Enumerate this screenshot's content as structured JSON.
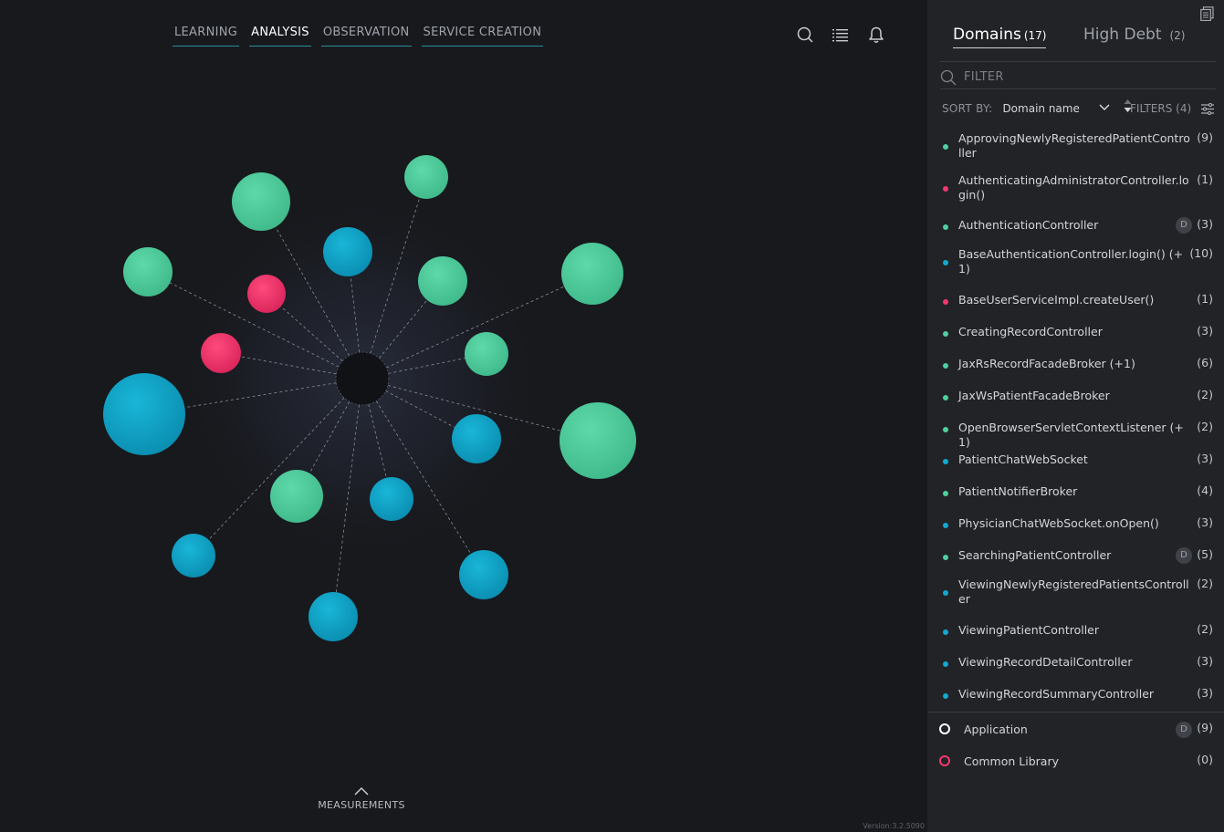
{
  "nav": {
    "tabs": [
      {
        "label": "LEARNING"
      },
      {
        "label": "ANALYSIS"
      },
      {
        "label": "OBSERVATION"
      },
      {
        "label": "SERVICE CREATION"
      }
    ],
    "active_tab": "ANALYSIS"
  },
  "toolbar_icons": [
    "search-icon",
    "list-icon",
    "bell-icon"
  ],
  "measurements": {
    "label": "MEASUREMENTS"
  },
  "version": "Version:3.2.5090",
  "colors": {
    "green": "#4fcf9f",
    "blue": "#12a9cf",
    "pink": "#f2386e",
    "hub": "#111215",
    "background": "#18191d",
    "panel": "#222327"
  },
  "panel": {
    "tabs": [
      {
        "label": "Domains",
        "count": "(17)"
      },
      {
        "label": "High Debt",
        "count": "(2)"
      }
    ],
    "filter_placeholder": "FILTER",
    "sort_by_label": "SORT BY:",
    "sort_value": "Domain name",
    "filters_label": "FILTERS (4)",
    "domains": [
      {
        "name": "ApprovingNewlyRegisteredPatientController",
        "count": "(9)",
        "color": "#4fcf9f",
        "badge": ""
      },
      {
        "name": "AuthenticatingAdministratorController.login()",
        "count": "(1)",
        "color": "#f2386e",
        "badge": ""
      },
      {
        "name": "AuthenticationController",
        "count": "(3)",
        "color": "#4fcf9f",
        "badge": "D"
      },
      {
        "name": "BaseAuthenticationController.login() (+1)",
        "count": "(10)",
        "color": "#12a9cf",
        "badge": ""
      },
      {
        "name": "BaseUserServiceImpl.createUser()",
        "count": "(1)",
        "color": "#f2386e",
        "badge": ""
      },
      {
        "name": "CreatingRecordController",
        "count": "(3)",
        "color": "#4fcf9f",
        "badge": ""
      },
      {
        "name": "JaxRsRecordFacadeBroker (+1)",
        "count": "(6)",
        "color": "#4fcf9f",
        "badge": ""
      },
      {
        "name": "JaxWsPatientFacadeBroker",
        "count": "(2)",
        "color": "#4fcf9f",
        "badge": ""
      },
      {
        "name": "OpenBrowserServletContextListener (+1)",
        "count": "(2)",
        "color": "#4fcf9f",
        "badge": ""
      },
      {
        "name": "PatientChatWebSocket",
        "count": "(3)",
        "color": "#12a9cf",
        "badge": ""
      },
      {
        "name": "PatientNotifierBroker",
        "count": "(4)",
        "color": "#4fcf9f",
        "badge": ""
      },
      {
        "name": "PhysicianChatWebSocket.onOpen()",
        "count": "(3)",
        "color": "#12a9cf",
        "badge": ""
      },
      {
        "name": "SearchingPatientController",
        "count": "(5)",
        "color": "#4fcf9f",
        "badge": "D"
      },
      {
        "name": "ViewingNewlyRegisteredPatientsController",
        "count": "(2)",
        "color": "#12a9cf",
        "badge": ""
      },
      {
        "name": "ViewingPatientController",
        "count": "(2)",
        "color": "#12a9cf",
        "badge": ""
      },
      {
        "name": "ViewingRecordDetailController",
        "count": "(3)",
        "color": "#12a9cf",
        "badge": ""
      },
      {
        "name": "ViewingRecordSummaryController",
        "count": "(3)",
        "color": "#12a9cf",
        "badge": ""
      }
    ],
    "legend": [
      {
        "name": "Application",
        "count": "(9)",
        "ring_color": "#ffffff",
        "badge": "D"
      },
      {
        "name": "Common Library",
        "count": "(0)",
        "ring_color": "#f2386e",
        "badge": ""
      }
    ]
  },
  "graph": {
    "nodes": [
      {
        "color": "green"
      },
      {
        "color": "green"
      },
      {
        "color": "blue"
      },
      {
        "color": "green"
      },
      {
        "color": "pink"
      },
      {
        "color": "green"
      },
      {
        "color": "green"
      },
      {
        "color": "pink"
      },
      {
        "color": "green"
      },
      {
        "color": "blue"
      },
      {
        "color": "blue"
      },
      {
        "color": "green"
      },
      {
        "color": "green"
      },
      {
        "color": "blue"
      },
      {
        "color": "blue"
      },
      {
        "color": "blue"
      },
      {
        "color": "blue"
      }
    ]
  }
}
